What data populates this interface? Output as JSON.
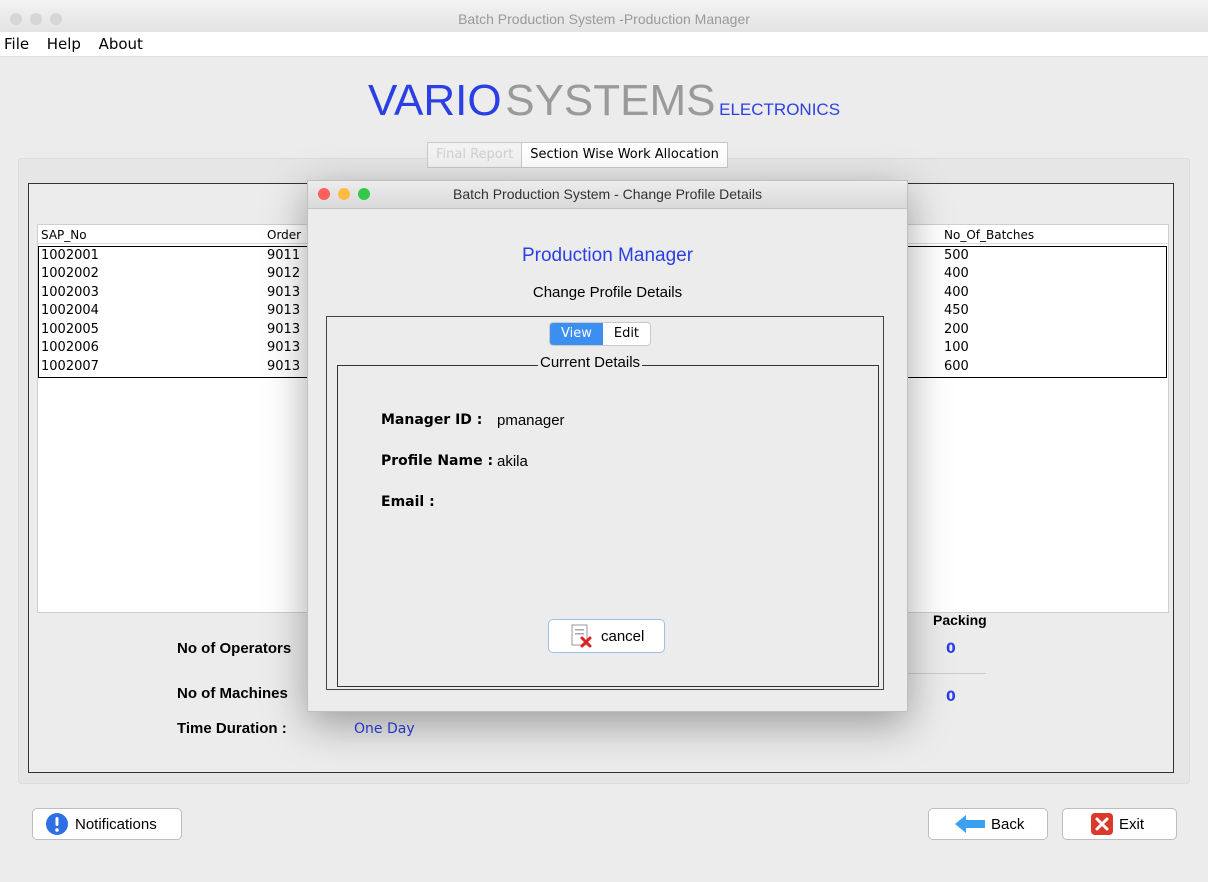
{
  "window": {
    "title": "Batch Production System -Production Manager"
  },
  "menu": {
    "items": [
      "File",
      "Help",
      "About"
    ]
  },
  "brand": {
    "main": "VARIO",
    "second": "SYSTEMS",
    "third": "ELECTRONICS"
  },
  "tabs": {
    "final_report": "Final Report",
    "section_wise": "Section Wise Work Allocation"
  },
  "table": {
    "columns": {
      "sap": "SAP_No",
      "order": "Order",
      "batches": "No_Of_Batches"
    },
    "rows": [
      {
        "sap": "1002001",
        "order": "9011",
        "batches": "500"
      },
      {
        "sap": "1002002",
        "order": "9012",
        "batches": "400"
      },
      {
        "sap": "1002003",
        "order": "9013",
        "batches": "400"
      },
      {
        "sap": "1002004",
        "order": "9013",
        "batches": "450"
      },
      {
        "sap": "1002005",
        "order": "9013",
        "batches": "200"
      },
      {
        "sap": "1002006",
        "order": "9013",
        "batches": "100"
      },
      {
        "sap": "1002007",
        "order": "9013",
        "batches": "600"
      }
    ]
  },
  "summary": {
    "operators_label": "No of Operators",
    "machines_label": "No of Machines",
    "time_label": "Time Duration   :",
    "time_value": "One Day",
    "packing_label": "Packing",
    "packing_operators": "0",
    "packing_machines": "0"
  },
  "buttons": {
    "notifications": "Notifications",
    "back": "Back",
    "exit": "Exit"
  },
  "dialog": {
    "title": "Batch Production System - Change Profile Details",
    "heading": "Production Manager",
    "subheading": "Change Profile Details",
    "tab_view": "View",
    "tab_edit": "Edit",
    "legend": "Current Details",
    "manager_id_label": "Manager ID :",
    "manager_id_value": "pmanager",
    "profile_name_label": "Profile Name :",
    "profile_name_value": "akila",
    "email_label": "Email :",
    "cancel": "cancel"
  },
  "colors": {
    "accent": "#2a3fe4",
    "tab_selected": "#3b8ff0"
  }
}
